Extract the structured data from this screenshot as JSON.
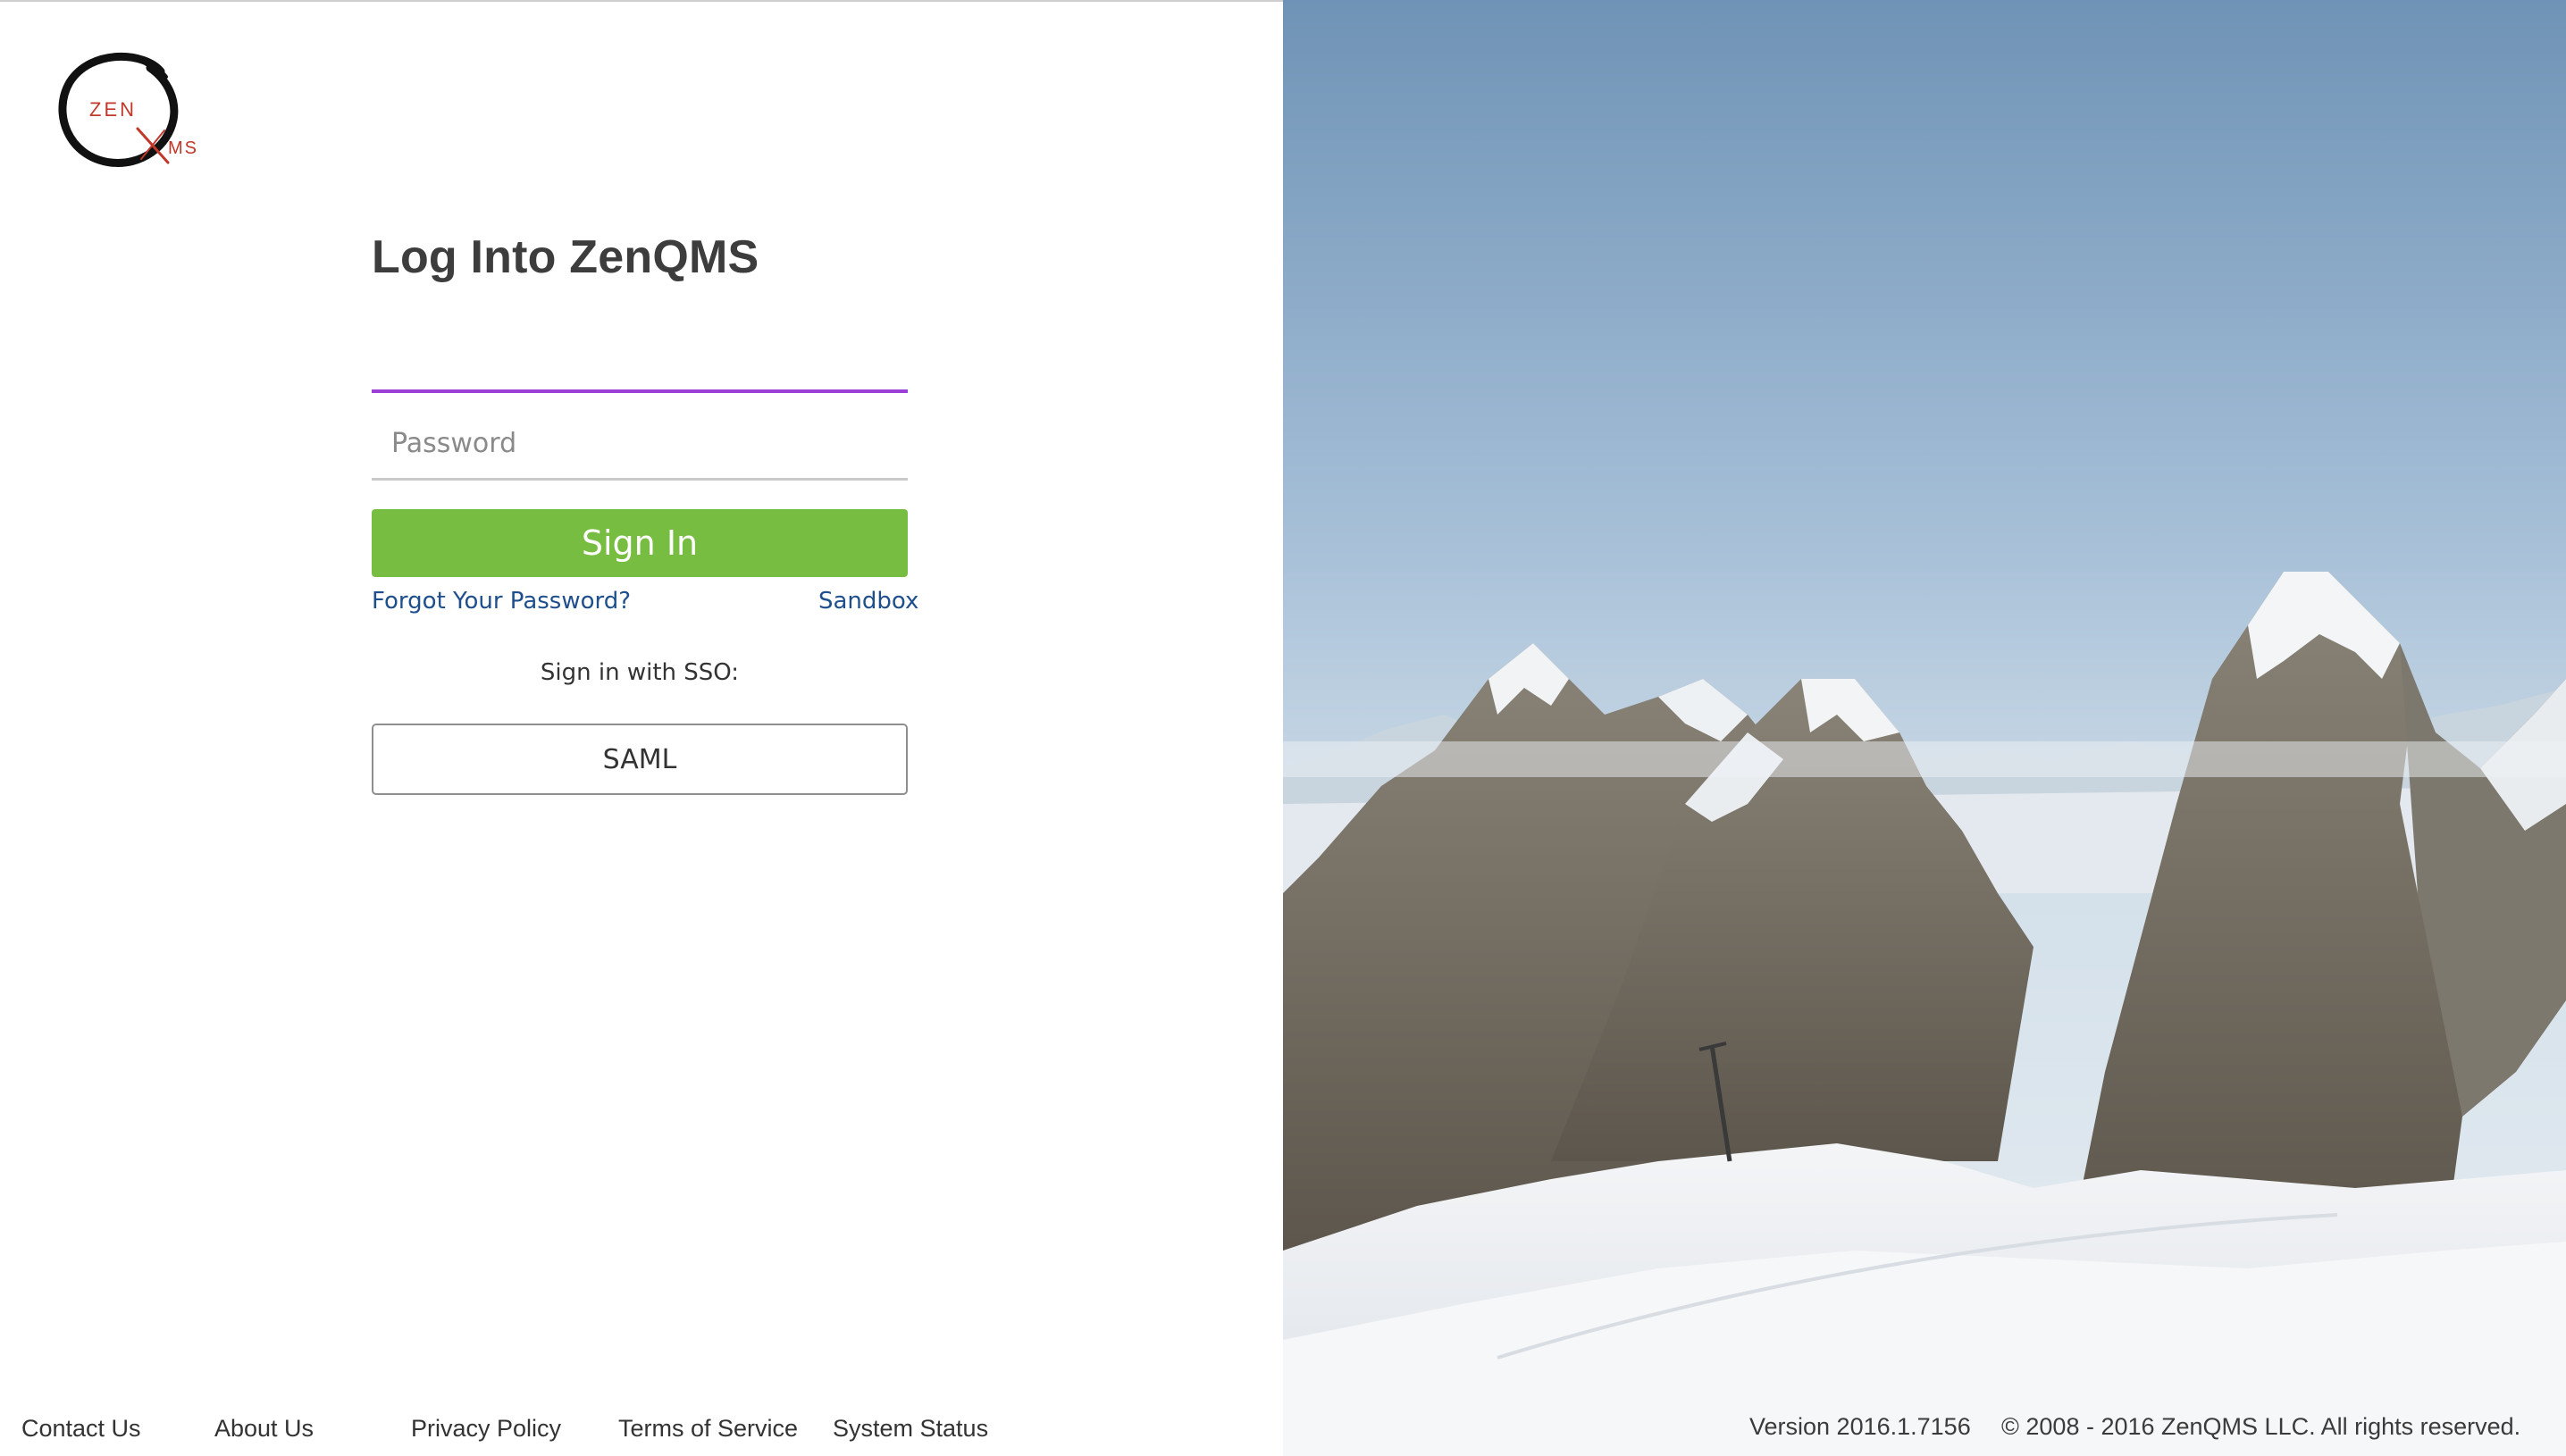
{
  "brand": {
    "logo_icon": "zenqms-enso-circle-logo",
    "logo_text_top": "ZEN",
    "logo_text_bottom": "MS",
    "accent_color": "#9b3fd6",
    "primary_button_color": "#77bd42",
    "link_color": "#1e4f8c"
  },
  "login": {
    "title": "Log Into ZenQMS",
    "username_value": "",
    "username_placeholder": "",
    "password_value": "",
    "password_placeholder": "Password",
    "signin_label": "Sign In",
    "forgot_label": "Forgot Your Password?",
    "sandbox_label": "Sandbox",
    "sso_label": "Sign in with SSO:",
    "saml_label": "SAML"
  },
  "footer": {
    "links": [
      "Contact Us",
      "About Us",
      "Privacy Policy",
      "Terms of Service",
      "System Status"
    ],
    "version_label": "Version  2016.1.7156",
    "copyright": "© 2008 - 2016 ZenQMS LLC. All rights reserved."
  },
  "background": {
    "image": "snowy-mountain-peaks-photo"
  }
}
